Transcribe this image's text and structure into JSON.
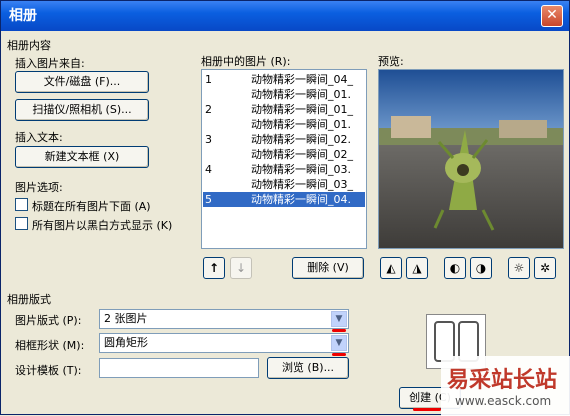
{
  "window": {
    "title": "相册",
    "close_glyph": "✕"
  },
  "album_content": {
    "group_label": "相册内容",
    "insert_from_label": "插入图片来自:",
    "file_disk_button": "文件/磁盘 (F)...",
    "scanner_button": "扫描仪/照相机 (S)...",
    "insert_text_label": "插入文本:",
    "new_textbox_button": "新建文本框 (X)",
    "picture_options_label": "图片选项:",
    "caption_checkbox": "标题在所有图片下面 (A)",
    "bw_checkbox": "所有图片以黑白方式显示 (K)"
  },
  "pictures_list": {
    "label": "相册中的图片 (R):",
    "rows": [
      {
        "num": "1",
        "name": "动物精彩一瞬间_04_"
      },
      {
        "num": "",
        "name": "动物精彩一瞬间_01."
      },
      {
        "num": "2",
        "name": "动物精彩一瞬间_01_"
      },
      {
        "num": "",
        "name": "动物精彩一瞬间_01."
      },
      {
        "num": "3",
        "name": "动物精彩一瞬间_02."
      },
      {
        "num": "",
        "name": "动物精彩一瞬间_02_"
      },
      {
        "num": "4",
        "name": "动物精彩一瞬间_03."
      },
      {
        "num": "",
        "name": "动物精彩一瞬间_03_"
      },
      {
        "num": "5",
        "name": "动物精彩一瞬间_04."
      }
    ],
    "selected_index": 8,
    "move_up_glyph": "↑",
    "move_down_glyph": "↓",
    "delete_button": "删除 (V)"
  },
  "preview": {
    "label": "预览:"
  },
  "layout": {
    "group_label": "相册版式",
    "picture_layout_label": "图片版式 (P):",
    "picture_layout_value": "2 张图片",
    "frame_shape_label": "相框形状 (M):",
    "frame_shape_value": "圆角矩形",
    "design_template_label": "设计模板 (T):",
    "design_template_value": "",
    "browse_button": "浏览 (B)...",
    "create_button": "创建 (C)"
  },
  "watermark": {
    "title": "易采站长站",
    "url": "www.easck.com"
  },
  "colors": {
    "title_bar": "#0a5fe0",
    "selection": "#316ac5",
    "annotation_red": "#e00000"
  }
}
